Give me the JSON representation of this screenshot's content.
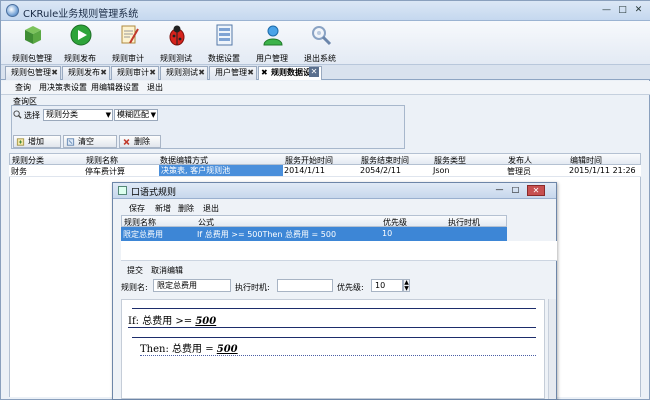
{
  "window": {
    "title": "CKRule业务规则管理系统",
    "min": "—",
    "max": "□",
    "close": "✕"
  },
  "toolbar": [
    {
      "label": "规则包管理",
      "icon": "package-icon"
    },
    {
      "label": "规则发布",
      "icon": "play-icon"
    },
    {
      "label": "规则审计",
      "icon": "audit-icon"
    },
    {
      "label": "规则测试",
      "icon": "bug-icon"
    },
    {
      "label": "数据设置",
      "icon": "data-settings-icon"
    },
    {
      "label": "用户管理",
      "icon": "user-icon"
    },
    {
      "label": "退出系统",
      "icon": "exit-icon"
    }
  ],
  "tabs": [
    {
      "label": "规则包管理"
    },
    {
      "label": "规则发布"
    },
    {
      "label": "规则审计"
    },
    {
      "label": "规则测试"
    },
    {
      "label": "用户管理"
    },
    {
      "label": "规则数据设置"
    }
  ],
  "submenu": [
    "查询",
    "用决策表设置",
    "用编辑器设置",
    "退出"
  ],
  "query": {
    "area_label": "查询区",
    "select_label": "选择",
    "select_value": "规则分类",
    "match_value": "模糊匹配",
    "add": "增加",
    "clear": "清空",
    "delete": "删除"
  },
  "grid": {
    "headers": [
      "规则分类",
      "规则名称",
      "数据编辑方式",
      "服务开始时间",
      "服务结束时间",
      "服务类型",
      "发布人",
      "编辑时间"
    ],
    "row": [
      "财务",
      "停车费计算",
      "决策表, 客户规则池",
      "2014/1/11",
      "2054/2/11",
      "Json",
      "管理员",
      "2015/1/11 21:26"
    ]
  },
  "dialog": {
    "title": "口语式规则",
    "menu": [
      "保存",
      "新增",
      "删除",
      "退出"
    ],
    "headers": [
      "规则名称",
      "公式",
      "优先级",
      "执行时机"
    ],
    "row": [
      "限定总费用",
      "If  总费用 >= 500Then  总费用 = 500",
      "10",
      ""
    ],
    "edit_bar": [
      "提交",
      "取消编辑"
    ],
    "name_label": "规则名:",
    "name_value": "限定总费用",
    "timing_label": "执行时机:",
    "timing_value": "",
    "priority_label": "优先级:",
    "priority_value": "10",
    "editor": {
      "if_prefix": "If: 总费用  >= ",
      "if_value": "500",
      "then_prefix": "Then: 总费用  = ",
      "then_value": "500"
    }
  }
}
